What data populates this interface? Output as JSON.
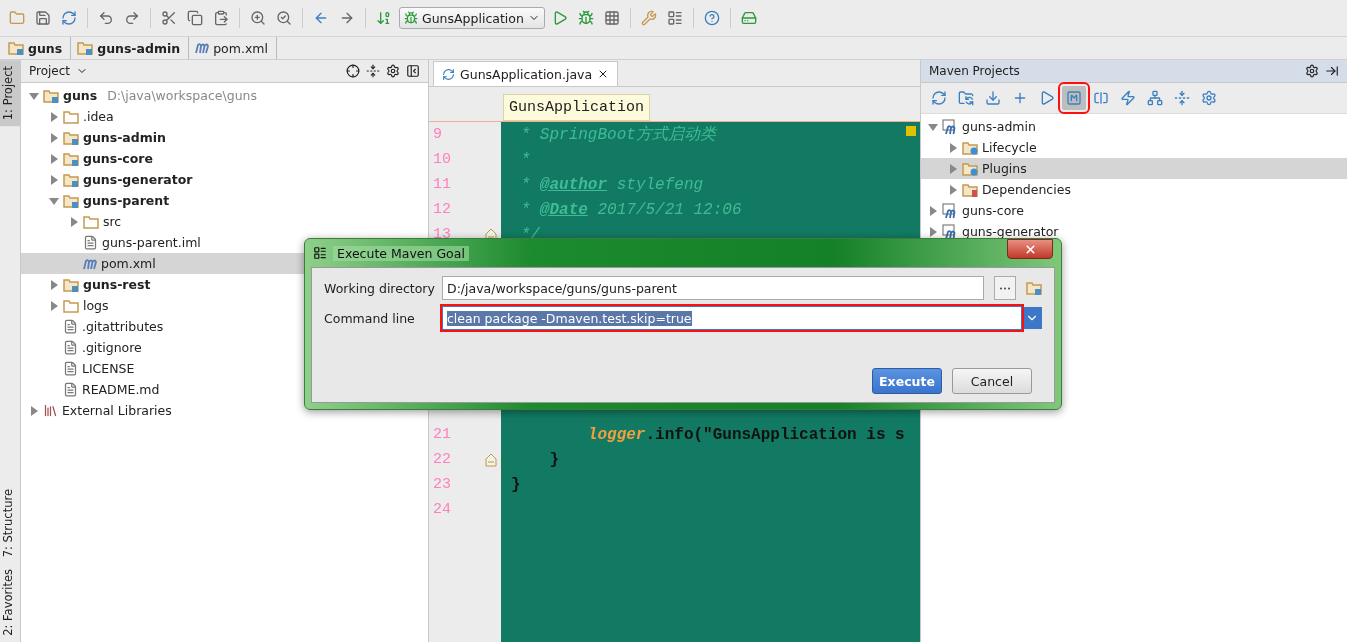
{
  "run_config": {
    "label": "GunsApplication"
  },
  "breadcrumbs": [
    {
      "label": "guns",
      "kind": "module"
    },
    {
      "label": "guns-admin",
      "kind": "module"
    },
    {
      "label": "pom.xml",
      "kind": "pom"
    }
  ],
  "side_tabs": [
    {
      "label": "1: Project",
      "selected": true
    },
    {
      "label": "7: Structure",
      "selected": false
    },
    {
      "label": "2: Favorites",
      "selected": false
    }
  ],
  "project_panel": {
    "title": "Project",
    "tree": [
      {
        "label": "guns",
        "hint": "D:\\java\\workspace\\guns",
        "kind": "module",
        "expanded": true,
        "selected": false,
        "children": [
          {
            "label": ".idea",
            "kind": "folder",
            "expanded": false,
            "selected": false
          },
          {
            "label": "guns-admin",
            "kind": "module",
            "expanded": false,
            "selected": false
          },
          {
            "label": "guns-core",
            "kind": "module",
            "expanded": false,
            "selected": false
          },
          {
            "label": "guns-generator",
            "kind": "module",
            "expanded": false,
            "selected": false
          },
          {
            "label": "guns-parent",
            "kind": "module",
            "expanded": true,
            "selected": false,
            "children": [
              {
                "label": "src",
                "kind": "folder",
                "expanded": false,
                "selected": false
              },
              {
                "label": "guns-parent.iml",
                "kind": "iml",
                "selected": false
              },
              {
                "label": "pom.xml",
                "kind": "pom",
                "selected": true
              }
            ]
          },
          {
            "label": "guns-rest",
            "kind": "module",
            "expanded": false,
            "selected": false
          },
          {
            "label": "logs",
            "kind": "folder",
            "expanded": false,
            "selected": false
          },
          {
            "label": ".gitattributes",
            "kind": "file",
            "selected": false
          },
          {
            "label": ".gitignore",
            "kind": "file",
            "selected": false
          },
          {
            "label": "LICENSE",
            "kind": "file",
            "selected": false
          },
          {
            "label": "README.md",
            "kind": "file",
            "selected": false
          }
        ]
      },
      {
        "label": "External Libraries",
        "kind": "library",
        "expanded": false,
        "selected": false
      }
    ]
  },
  "editor": {
    "tabs": [
      {
        "label": "GunsApplication.java",
        "selected": true
      }
    ],
    "crumb": "GunsApplication",
    "lines": [
      {
        "number": "9",
        "segments": [
          {
            "kind": "comment",
            "text": " * SpringBoot方式启动类"
          }
        ]
      },
      {
        "number": "10",
        "segments": [
          {
            "kind": "comment",
            "text": " *"
          }
        ]
      },
      {
        "number": "11",
        "segments": [
          {
            "kind": "comment",
            "text": " * "
          },
          {
            "kind": "doctag",
            "text": "@author"
          },
          {
            "kind": "comment",
            "text": " stylefeng"
          }
        ]
      },
      {
        "number": "12",
        "segments": [
          {
            "kind": "comment",
            "text": " * "
          },
          {
            "kind": "doctag",
            "text": "@Date"
          },
          {
            "kind": "comment",
            "text": " 2017/5/21 12:06"
          }
        ]
      },
      {
        "number": "13",
        "fold": true,
        "segments": [
          {
            "kind": "comment",
            "text": " */"
          }
        ]
      },
      {
        "number": "21",
        "kind": "statement",
        "segments": [
          {
            "kind": "field",
            "text": "logger"
          },
          {
            "kind": "plain",
            "text": ".info(\"GunsApplication is s"
          }
        ]
      },
      {
        "number": "22",
        "kind": "method_end",
        "fold": true,
        "segments": [
          {
            "kind": "plain",
            "text": "}"
          }
        ]
      },
      {
        "number": "23",
        "kind": "class_end",
        "segments": [
          {
            "kind": "plain",
            "text": "}"
          }
        ]
      },
      {
        "number": "24"
      }
    ]
  },
  "maven_panel": {
    "title": "Maven Projects",
    "toolbar": [
      {
        "pressed": false,
        "highlighted": false
      },
      {
        "pressed": false,
        "highlighted": false
      },
      {
        "pressed": false,
        "highlighted": false
      },
      {
        "pressed": false,
        "highlighted": false
      },
      {
        "pressed": false,
        "highlighted": false
      },
      {
        "pressed": true,
        "highlighted": true
      },
      {
        "pressed": false,
        "highlighted": false
      },
      {
        "pressed": false,
        "highlighted": false
      },
      {
        "pressed": false,
        "highlighted": false
      },
      {
        "pressed": false,
        "highlighted": false
      },
      {
        "pressed": false,
        "highlighted": false
      }
    ],
    "tree": [
      {
        "label": "guns-admin",
        "kind": "maven",
        "expanded": true,
        "selected": false,
        "children": [
          {
            "label": "Lifecycle",
            "kind": "goals",
            "expanded": false,
            "selected": false
          },
          {
            "label": "Plugins",
            "kind": "goals",
            "expanded": false,
            "selected": true
          },
          {
            "label": "Dependencies",
            "kind": "deps",
            "expanded": false,
            "selected": false
          }
        ]
      },
      {
        "label": "guns-core",
        "kind": "maven",
        "expanded": false,
        "selected": false
      },
      {
        "label": "guns-generator",
        "kind": "maven",
        "expanded": false,
        "selected": false
      }
    ]
  },
  "dialog": {
    "title": "Execute Maven Goal",
    "fields": [
      {
        "label": "Working directory",
        "value": "D:/java/workspace/guns/guns-parent",
        "kind": "browse",
        "highlighted": false
      },
      {
        "label": "Command line",
        "value": "clean package -Dmaven.test.skip=true",
        "kind": "combo",
        "highlighted": true
      }
    ],
    "buttons": [
      {
        "label": "Execute",
        "default": true
      },
      {
        "label": "Cancel",
        "default": false
      }
    ]
  }
}
